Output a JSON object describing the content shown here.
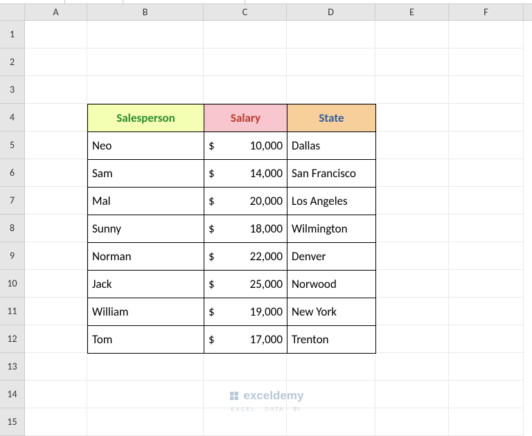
{
  "columns": [
    "A",
    "B",
    "C",
    "D",
    "E",
    "F"
  ],
  "rows": [
    "1",
    "2",
    "3",
    "4",
    "5",
    "6",
    "7",
    "8",
    "9",
    "10",
    "11",
    "12",
    "13",
    "14",
    "15"
  ],
  "headers": {
    "salesperson": "Salesperson",
    "salary": "Salary",
    "state": "State"
  },
  "currency": "$",
  "data": [
    {
      "name": "Neo",
      "salary": "10,000",
      "state": "Dallas"
    },
    {
      "name": "Sam",
      "salary": "14,000",
      "state": "San Francisco"
    },
    {
      "name": "Mal",
      "salary": "20,000",
      "state": "Los Angeles"
    },
    {
      "name": "Sunny",
      "salary": "18,000",
      "state": "Wilmington"
    },
    {
      "name": "Norman",
      "salary": "22,000",
      "state": "Denver"
    },
    {
      "name": "Jack",
      "salary": "25,000",
      "state": "Norwood"
    },
    {
      "name": "William",
      "salary": "19,000",
      "state": "New York"
    },
    {
      "name": "Tom",
      "salary": "17,000",
      "state": "Trenton"
    }
  ],
  "watermark": {
    "brand": "exceldemy",
    "tagline": "EXCEL · DATA · BI"
  }
}
